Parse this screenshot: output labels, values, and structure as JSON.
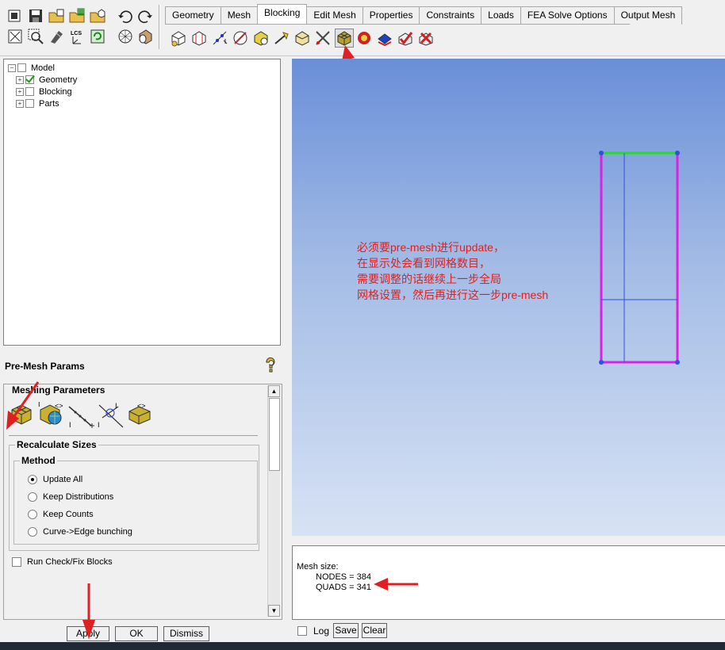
{
  "tabs": [
    "Geometry",
    "Mesh",
    "Blocking",
    "Edit Mesh",
    "Properties",
    "Constraints",
    "Loads",
    "FEA Solve Options",
    "Output Mesh"
  ],
  "active_tab": "Blocking",
  "toolbar_icons_row1": [
    "open-icon",
    "save-icon",
    "open-folder-icon",
    "grid-icon",
    "box-open-icon",
    "undo-icon",
    "redo-icon"
  ],
  "toolbar_icons_row2": [
    "fit-icon",
    "zoom-icon",
    "measure-icon",
    "lcs-icon",
    "refresh-icon",
    "sphere-icon",
    "cylinder-icon"
  ],
  "blocking_icons": [
    "create-block-icon",
    "split-block-icon",
    "vertex-icon",
    "edge-icon",
    "associate-icon",
    "move-vertex-icon",
    "transform-icon",
    "edit-block-icon",
    "pre-mesh-params-icon",
    "pre-mesh-quality-icon",
    "pre-mesh-smooth-icon",
    "check-blocks-icon",
    "delete-block-icon"
  ],
  "tree": {
    "root": "Model",
    "children": [
      {
        "label": "Geometry",
        "checked": true
      },
      {
        "label": "Blocking",
        "checked": false
      },
      {
        "label": "Parts",
        "checked": false
      }
    ]
  },
  "params": {
    "title": "Pre-Mesh Params",
    "help_icon": "help-icon",
    "meshing_label": "Meshing Parameters",
    "recalc_label": "Recalculate Sizes",
    "method_label": "Method",
    "methods": [
      "Update All",
      "Keep Distributions",
      "Keep Counts",
      "Curve->Edge bunching"
    ],
    "selected_method": "Update All",
    "run_check_label": "Run Check/Fix Blocks"
  },
  "buttons": {
    "apply": "Apply",
    "ok": "OK",
    "dismiss": "Dismiss"
  },
  "annotation": "必须要pre-mesh进行update，\n在显示处会看到网格数目，\n需要调整的话继续上一步全局\n网格设置，然后再进行这一步pre-mesh",
  "messages": {
    "line1": "Mesh size:",
    "nodes": "NODES = 384",
    "quads": "QUADS = 341"
  },
  "bottom": {
    "log_label": "Log",
    "save_label": "Save",
    "clear_label": "Clear"
  },
  "colors": {
    "viewport_top": "#6a8fd8",
    "viewport_bottom": "#d7e2f4",
    "annotation": "#e02020",
    "edge_magenta": "#e020e0",
    "edge_green": "#20e020",
    "edge_blue": "#3050e0"
  }
}
